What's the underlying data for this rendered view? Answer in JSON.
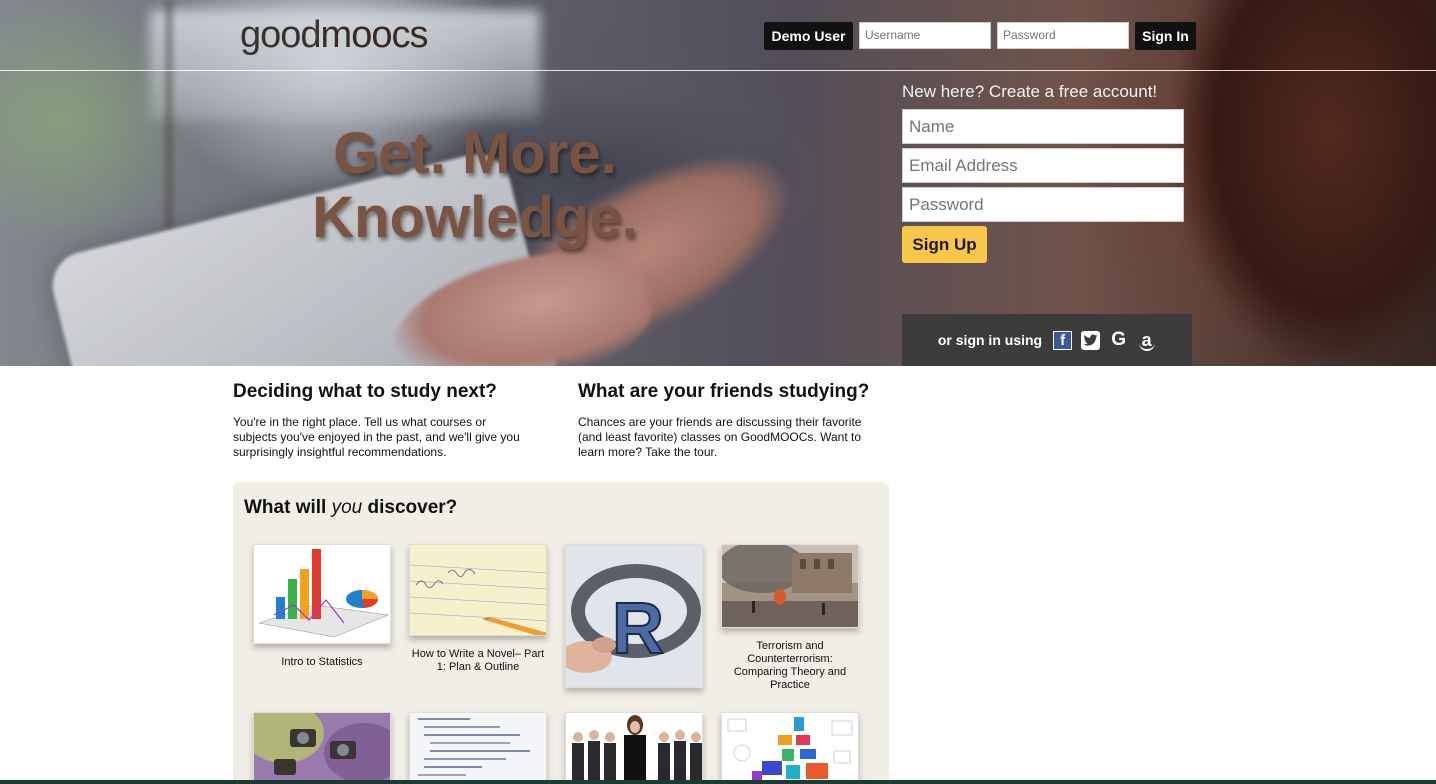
{
  "header": {
    "logo_prefix": "good",
    "logo_suffix": "moocs",
    "demo_user_label": "Demo User",
    "username_placeholder": "Username",
    "password_placeholder": "Password",
    "sign_in_label": "Sign In"
  },
  "hero": {
    "tagline_line1": "Get. More.",
    "tagline_line2": "Knowledge."
  },
  "signup": {
    "heading": "New here? Create a free account!",
    "name_placeholder": "Name",
    "email_placeholder": "Email Address",
    "password_placeholder": "Password",
    "button_label": "Sign Up",
    "social_label": "or sign in using",
    "social_icons": [
      "facebook-icon",
      "twitter-icon",
      "google-icon",
      "amazon-icon"
    ]
  },
  "info": {
    "col1_title": "Deciding what to study next?",
    "col1_text": "You're in the right place. Tell us what courses or subjects you've enjoyed in the past, and we'll give you surprisingly insightful recommendations.",
    "col2_title": "What are your friends studying?",
    "col2_text": "Chances are your friends are discussing their favorite (and least favorite) classes on GoodMOOCs. Want to learn more? Take the tour."
  },
  "discover": {
    "title_before": "What will ",
    "title_em": "you",
    "title_after": " discover?",
    "courses": [
      {
        "label": "Intro to Statistics"
      },
      {
        "label": "How to Write a Novel– Part 1: Plan & Outline"
      },
      {
        "label": ""
      },
      {
        "label": "Terrorism and Counterterrorism: Comparing Theory and Practice"
      },
      {
        "label": ""
      },
      {
        "label": ""
      },
      {
        "label": ""
      },
      {
        "label": ""
      }
    ]
  },
  "colors": {
    "accent_signup": "#f8c74a",
    "tagline": "#7a5442",
    "discover_bg": "#f1eee6",
    "social_bar": "#3c3c3c"
  }
}
